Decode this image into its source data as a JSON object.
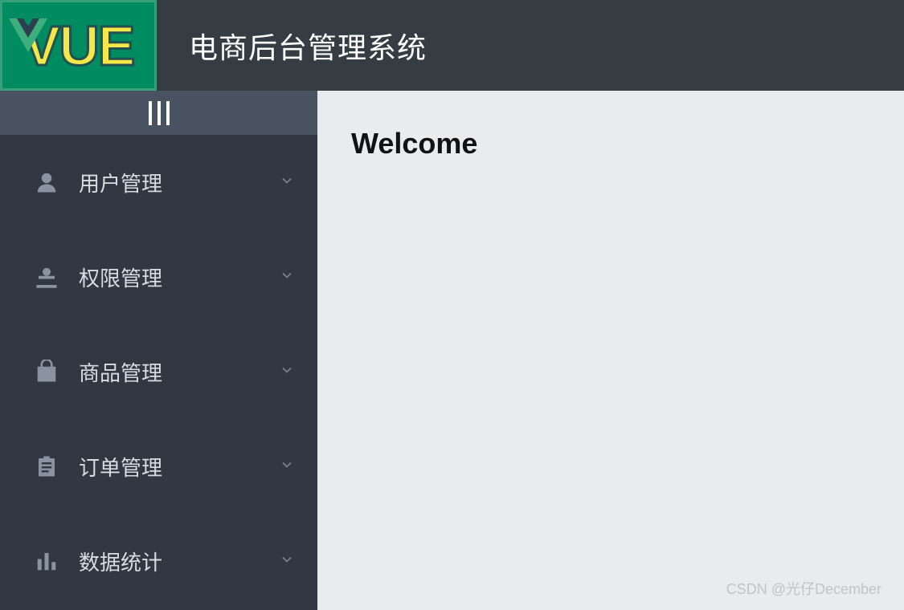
{
  "header": {
    "logo_text": "VUE",
    "title": "电商后台管理系统"
  },
  "sidebar": {
    "items": [
      {
        "icon": "user-icon",
        "label": "用户管理"
      },
      {
        "icon": "permission-icon",
        "label": "权限管理"
      },
      {
        "icon": "goods-icon",
        "label": "商品管理"
      },
      {
        "icon": "order-icon",
        "label": "订单管理"
      },
      {
        "icon": "report-icon",
        "label": "数据统计"
      }
    ]
  },
  "main": {
    "welcome": "Welcome"
  },
  "watermark": "CSDN @光仔December"
}
